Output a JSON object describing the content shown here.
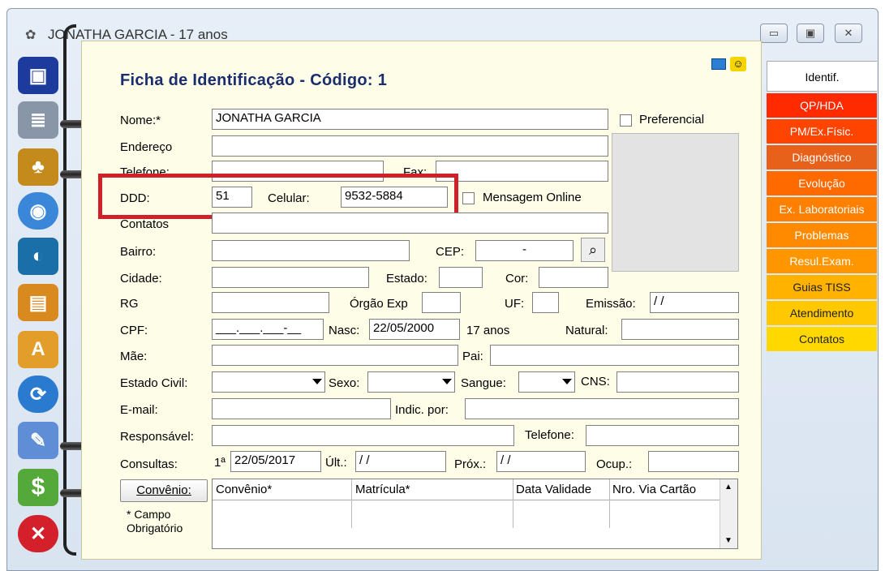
{
  "window": {
    "title": "JONATHA GARCIA - 17 anos",
    "minimize_glyph": "▭",
    "maximize_glyph": "▣",
    "close_glyph": "✕"
  },
  "form": {
    "title": "Ficha de Identificação - Código: 1",
    "nome_label": "Nome:*",
    "nome_value": "JONATHA GARCIA",
    "preferencial_label": "Preferencial",
    "endereco_label": "Endereço",
    "telefone_label": "Telefone:",
    "fax_label": "Fax:",
    "ddd_label": "DDD:",
    "ddd_value": "51",
    "celular_label": "Celular:",
    "celular_value": "9532-5884",
    "mensagem_label": "Mensagem Online",
    "contatos_label": "Contatos",
    "bairro_label": "Bairro:",
    "cep_label": "CEP:",
    "cep_value": "-",
    "cidade_label": "Cidade:",
    "estado_label": "Estado:",
    "cor_label": "Cor:",
    "rg_label": "RG",
    "orgao_label": "Órgão Exp",
    "uf_label": "UF:",
    "emissao_label": "Emissão:",
    "emissao_value": "/ /",
    "cpf_label": "CPF:",
    "cpf_value": "___.___.___-__",
    "nasc_label": "Nasc:",
    "nasc_value": "22/05/2000",
    "idade": "17 anos",
    "natural_label": "Natural:",
    "mae_label": "Mãe:",
    "pai_label": "Pai:",
    "estado_civil_label": "Estado Civil:",
    "sexo_label": "Sexo:",
    "sangue_label": "Sangue:",
    "cns_label": "CNS:",
    "email_label": "E-mail:",
    "indic_label": "Indic. por:",
    "responsavel_label": "Responsável:",
    "telefone2_label": "Telefone:",
    "consultas_label": "Consultas:",
    "consultas_prefix": "1ª",
    "consultas_value": "22/05/2017",
    "ult_label": "Últ.:",
    "ult_value": "/ /",
    "prox_label": "Próx.:",
    "prox_value": "/ /",
    "ocup_label": "Ocup.:",
    "convenio_button": "Convênio:",
    "campo_obrigatorio": "* Campo Obrigatório",
    "grid_headers": [
      "Convênio*",
      "Matrícula*",
      "Data Validade",
      "Nro. Via Cartão"
    ]
  },
  "tabs": [
    {
      "label": "Identif.",
      "color": "#ffffff"
    },
    {
      "label": "QP/HDA",
      "color": "#ff2a00"
    },
    {
      "label": "PM/Ex.Físic.",
      "color": "#ff4400"
    },
    {
      "label": "Diagnóstico",
      "color": "#e8611a"
    },
    {
      "label": "Evolução",
      "color": "#ff6a00"
    },
    {
      "label": "Ex. Laboratoriais",
      "color": "#ff8000"
    },
    {
      "label": "Problemas",
      "color": "#ff8a00"
    },
    {
      "label": "Resul.Exam.",
      "color": "#ff9600"
    },
    {
      "label": "Guias TISS",
      "color": "#ffb300"
    },
    {
      "label": "Atendimento",
      "color": "#ffc800"
    },
    {
      "label": "Contatos",
      "color": "#ffd800"
    }
  ],
  "left_icons": [
    "save-icon",
    "notebook-icon",
    "cards-icon",
    "cd-icon",
    "camera-icon",
    "books-icon",
    "font-icon",
    "sync-icon",
    "brush-icon",
    "dollar-icon",
    "close-icon"
  ]
}
